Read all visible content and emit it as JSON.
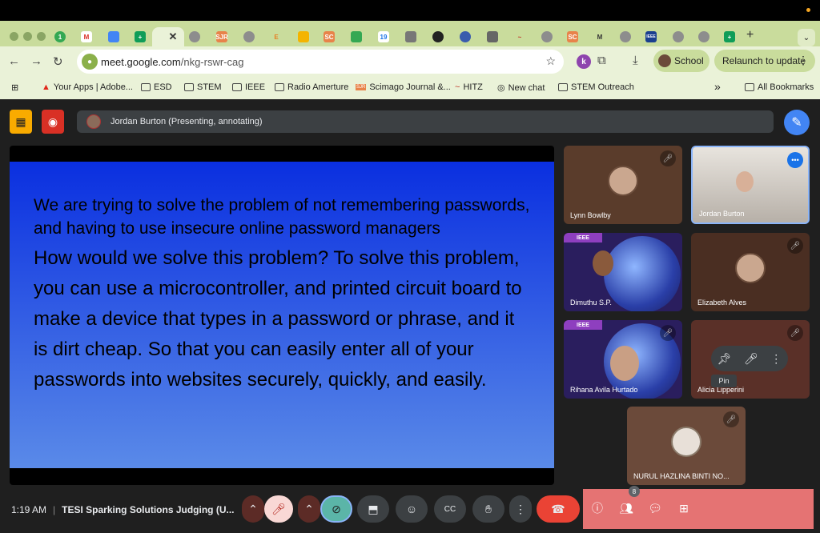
{
  "browser": {
    "url_host": "meet.google.com",
    "url_path": "/nkg-rswr-cag",
    "profile_label": "School",
    "relaunch_label": "Relaunch to update",
    "tab_favicons": [
      "1",
      "M",
      "",
      "+",
      "",
      "",
      "SJR",
      "",
      "E",
      "",
      "SC",
      "",
      "19",
      "",
      "",
      "",
      "",
      "",
      "",
      "SC",
      "M",
      "",
      "",
      "IEEE",
      "",
      "",
      "+"
    ],
    "bookmarks": [
      {
        "label": "Your Apps | Adobe...",
        "icon": "adobe-icon"
      },
      {
        "label": "ESD",
        "icon": "folder-icon"
      },
      {
        "label": "STEM",
        "icon": "folder-icon"
      },
      {
        "label": "IEEE",
        "icon": "folder-icon"
      },
      {
        "label": "Radio Amerture",
        "icon": "folder-icon"
      },
      {
        "label": "Scimago Journal &...",
        "icon": "sjr-icon"
      },
      {
        "label": "HITZ",
        "icon": "hitz-icon"
      },
      {
        "label": "New chat",
        "icon": "openai-icon"
      },
      {
        "label": "STEM Outreach",
        "icon": "folder-icon"
      }
    ],
    "overflow_label": "»",
    "all_bookmarks_label": "All Bookmarks"
  },
  "meet": {
    "presenting_label": "Jordan Burton (Presenting, annotating)",
    "slide": {
      "paragraph1": "We are trying to solve the problem of not remembering passwords, and having to use insecure online password managers",
      "paragraph2": "How would we solve this problem? To solve this problem, you can use a microcontroller, and printed circuit board to make a device that types in a password or phrase, and it is dirt cheap. So that you can easily enter all of your passwords into websites securely, quickly, and easily."
    },
    "participants": [
      {
        "name": "Lynn Bowlby",
        "muted": true
      },
      {
        "name": "Jordan Burton",
        "muted": false,
        "speaking": true
      },
      {
        "name": "Dimuthu S.P.",
        "muted": false,
        "badge": "IEEE"
      },
      {
        "name": "Elizabeth Alves",
        "muted": true
      },
      {
        "name": "Rihana Avila Hurtado",
        "muted": true,
        "badge": "IEEE"
      },
      {
        "name": "Alicia Lipperini",
        "muted": true
      },
      {
        "name": "NURUL HAZLINA BINTI NO...",
        "muted": true
      }
    ],
    "pin_tooltip": "Pin",
    "time": "1:19 AM",
    "meeting_title": "TESI Sparking Solutions Judging (U...",
    "people_count": "8",
    "colors": {
      "accent": "#4285f4",
      "end_call": "#ea4335",
      "panel": "#e57373",
      "slide_top": "#0a2fe0"
    }
  }
}
